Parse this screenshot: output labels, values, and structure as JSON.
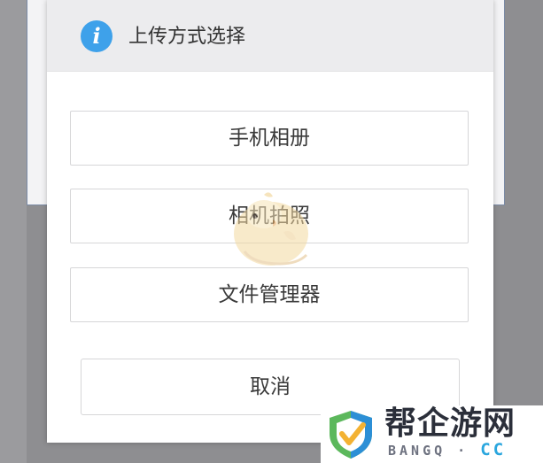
{
  "dialog": {
    "title": "上传方式选择",
    "icon": "info-icon",
    "options": [
      {
        "label": "手机相册"
      },
      {
        "label": "相机拍照"
      },
      {
        "label": "文件管理器"
      }
    ],
    "cancel_label": "取消"
  },
  "watermark": {
    "title": "帮企游网",
    "subtitle": "BANGQ ·",
    "subtitle_suffix": "CC"
  },
  "colors": {
    "accent": "#3ea1ea",
    "header_bg": "#ececee",
    "overlay": "#8e8e91"
  }
}
